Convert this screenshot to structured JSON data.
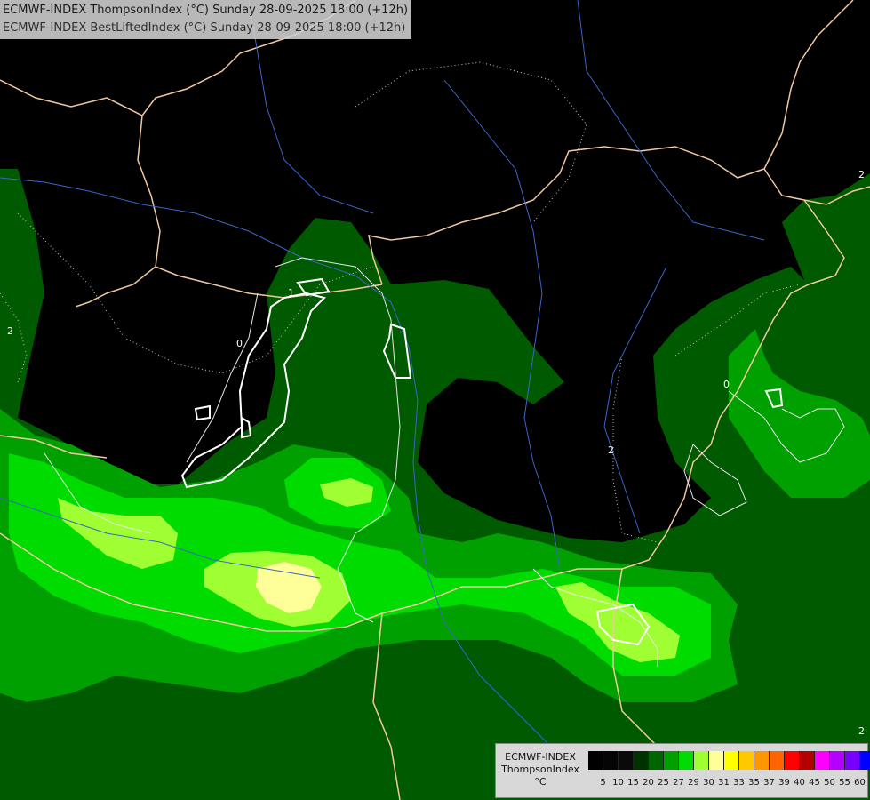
{
  "header": {
    "line1": "ECMWF-INDEX ThompsonIndex (°C) Sunday 28-09-2025 18:00 (+12h)",
    "line2": "ECMWF-INDEX BestLiftedIndex (°C) Sunday 28-09-2025 18:00 (+12h)"
  },
  "contour_labels": [
    "0",
    "1",
    "2",
    "2",
    "0",
    "2",
    "2"
  ],
  "legend": {
    "title_line1": "ECMWF-INDEX",
    "title_line2": "ThompsonIndex",
    "title_line3": "°C",
    "ticks": [
      "5",
      "10",
      "15",
      "20",
      "25",
      "27",
      "29",
      "30",
      "31",
      "33",
      "35",
      "37",
      "39",
      "40",
      "45",
      "50",
      "55",
      "60"
    ],
    "colors": [
      "#000000",
      "#050505",
      "#0a0a0a",
      "#003200",
      "#006400",
      "#00a000",
      "#00dc00",
      "#a0ff32",
      "#ffff9a",
      "#ffff00",
      "#ffc800",
      "#ff9600",
      "#ff6400",
      "#ff0000",
      "#b40000",
      "#ff00ff",
      "#b400ff",
      "#7800ff",
      "#0000ff"
    ]
  },
  "colors": {
    "background": "#000000",
    "border": "#f0c8a0",
    "river": "#3c64c8"
  }
}
